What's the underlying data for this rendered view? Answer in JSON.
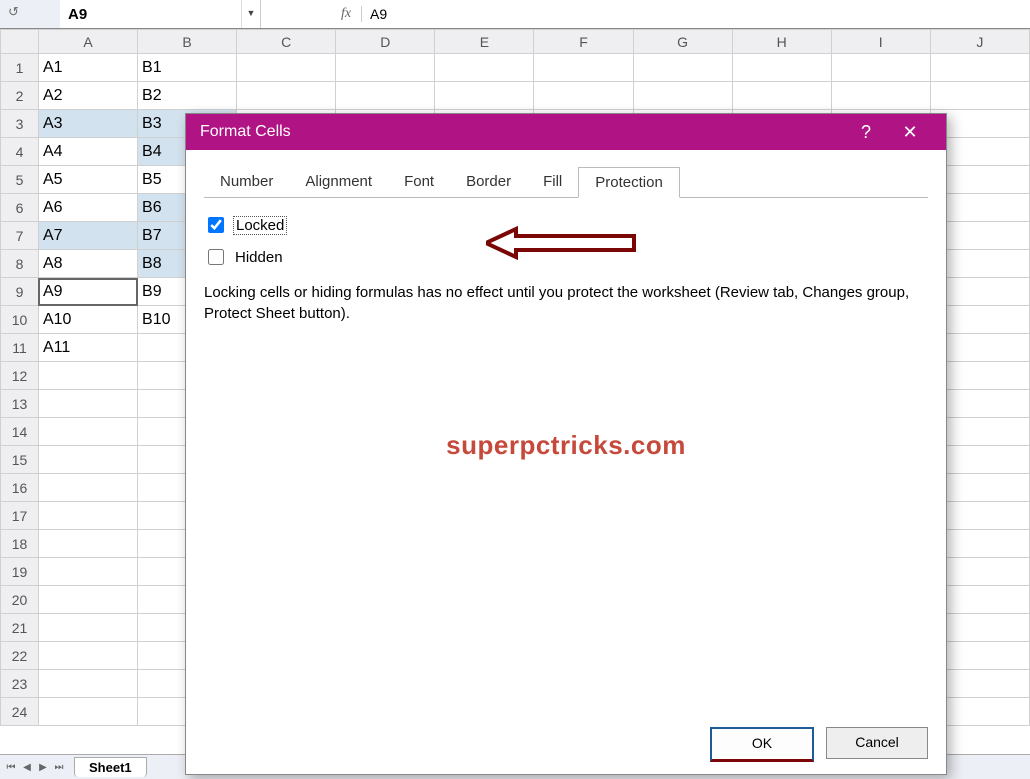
{
  "nameBox": "A9",
  "formulaPrefix": "fx",
  "formulaValue": "A9",
  "columns": [
    "A",
    "B",
    "C",
    "D",
    "E",
    "F",
    "G",
    "H",
    "I",
    "J"
  ],
  "rows": [
    {
      "n": 1,
      "A": "A1",
      "B": "B1"
    },
    {
      "n": 2,
      "A": "A2",
      "B": "B2"
    },
    {
      "n": 3,
      "A": "A3",
      "B": "B3",
      "sel": true
    },
    {
      "n": 4,
      "A": "A4",
      "B": "B4",
      "selB": true
    },
    {
      "n": 5,
      "A": "A5",
      "B": "B5"
    },
    {
      "n": 6,
      "A": "A6",
      "B": "B6",
      "selB": true
    },
    {
      "n": 7,
      "A": "A7",
      "B": "B7",
      "sel": true
    },
    {
      "n": 8,
      "A": "A8",
      "B": "B8",
      "selB": true
    },
    {
      "n": 9,
      "A": "A9",
      "B": "B9",
      "active": true
    },
    {
      "n": 10,
      "A": "A10",
      "B": "B10"
    },
    {
      "n": 11,
      "A": "A11",
      "B": ""
    },
    {
      "n": 12
    },
    {
      "n": 13
    },
    {
      "n": 14
    },
    {
      "n": 15
    },
    {
      "n": 16
    },
    {
      "n": 17
    },
    {
      "n": 18
    },
    {
      "n": 19
    },
    {
      "n": 20
    },
    {
      "n": 21
    },
    {
      "n": 22
    },
    {
      "n": 23
    },
    {
      "n": 24
    }
  ],
  "sheetTab": "Sheet1",
  "dialog": {
    "title": "Format Cells",
    "tabs": [
      "Number",
      "Alignment",
      "Font",
      "Border",
      "Fill",
      "Protection"
    ],
    "activeTab": "Protection",
    "lockedLabel": "Locked",
    "lockedChecked": true,
    "hiddenLabel": "Hidden",
    "hiddenChecked": false,
    "description": "Locking cells or hiding formulas has no effect until you protect the worksheet (Review tab, Changes group, Protect Sheet button).",
    "ok": "OK",
    "cancel": "Cancel",
    "help": "?",
    "close": "✕"
  },
  "watermark": "superpctricks.com"
}
